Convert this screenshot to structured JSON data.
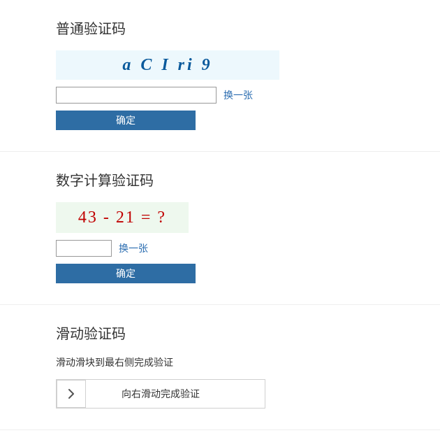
{
  "section1": {
    "title": "普通验证码",
    "captcha_text": "a C I ri 9",
    "input_value": "",
    "refresh": "换一张",
    "confirm": "确定"
  },
  "section2": {
    "title": "数字计算验证码",
    "captcha_text": "43 - 21 = ?",
    "input_value": "",
    "refresh": "换一张",
    "confirm": "确定"
  },
  "section3": {
    "title": "滑动验证码",
    "desc": "滑动滑块到最右侧完成验证",
    "slider_label": "向右滑动完成验证"
  }
}
